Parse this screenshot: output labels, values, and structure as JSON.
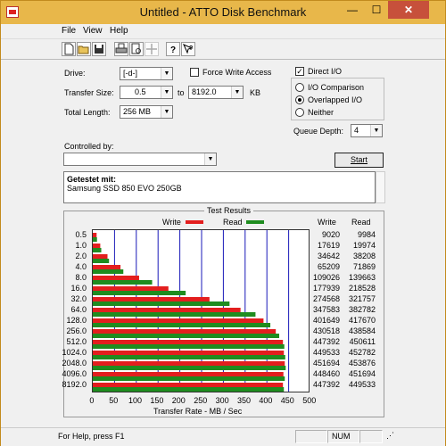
{
  "window": {
    "title": "Untitled - ATTO Disk Benchmark",
    "minimize": "—",
    "maximize": "☐",
    "close": "✕"
  },
  "menu": {
    "file": "File",
    "view": "View",
    "help": "Help"
  },
  "toolbar": {
    "icons": [
      "new-file-icon",
      "open-folder-icon",
      "save-icon",
      "print-icon",
      "print-preview-icon",
      "move-icon",
      "help-icon",
      "context-help-icon"
    ]
  },
  "settings": {
    "drive_label": "Drive:",
    "drive_value": "[-d-]",
    "transfer_size_label": "Transfer Size:",
    "transfer_from": "0.5",
    "transfer_to_label": "to",
    "transfer_to": "8192.0",
    "transfer_unit": "KB",
    "total_length_label": "Total Length:",
    "total_length": "256 MB",
    "force_write_access_label": "Force Write Access",
    "force_write_access_checked": false,
    "direct_io_label": "Direct I/O",
    "direct_io_checked": true,
    "io_comparison_label": "I/O Comparison",
    "overlapped_io_label": "Overlapped I/O",
    "neither_label": "Neither",
    "selected_io_mode": "Overlapped I/O",
    "queue_depth_label": "Queue Depth:",
    "queue_depth": "4",
    "controlled_by_label": "Controlled by:",
    "controlled_by_value": "",
    "start_button": "Start"
  },
  "description": {
    "heading": "Getestet mit:",
    "text": "Samsung SSD 850 EVO 250GB"
  },
  "results_title": "Test Results",
  "legend": {
    "write": "Write",
    "read": "Read"
  },
  "columns": {
    "write": "Write",
    "read": "Read"
  },
  "colors": {
    "write": "#e31e1e",
    "read": "#1f8c1f",
    "grid": "#1a1ab8"
  },
  "chart_data": {
    "type": "bar",
    "categories": [
      "0.5",
      "1.0",
      "2.0",
      "4.0",
      "8.0",
      "16.0",
      "32.0",
      "64.0",
      "128.0",
      "256.0",
      "512.0",
      "1024.0",
      "2048.0",
      "4096.0",
      "8192.0"
    ],
    "series": [
      {
        "name": "Write",
        "values": [
          9020,
          17619,
          34642,
          65209,
          109026,
          177939,
          274568,
          347583,
          401649,
          430518,
          447392,
          449533,
          451694,
          448460,
          447392
        ]
      },
      {
        "name": "Read",
        "values": [
          9984,
          19974,
          38208,
          71869,
          139663,
          218528,
          321757,
          382782,
          417670,
          438584,
          450611,
          452782,
          453876,
          451694,
          449533
        ]
      }
    ],
    "xlabel": "Transfer Rate - MB / Sec",
    "xticks": [
      "0",
      "50",
      "100",
      "150",
      "200",
      "250",
      "300",
      "350",
      "400",
      "450",
      "500"
    ],
    "xlim": [
      0,
      500
    ],
    "value_units": "KB/s"
  },
  "status": {
    "text": "For Help, press F1",
    "num": "NUM"
  }
}
